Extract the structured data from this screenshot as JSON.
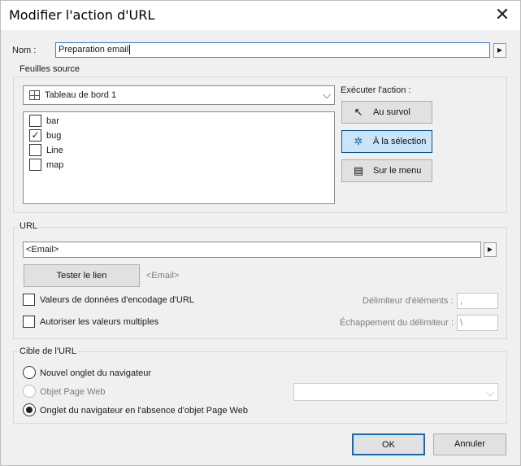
{
  "window": {
    "title": "Modifier l'action d'URL",
    "close_icon": "close-icon"
  },
  "name": {
    "label": "Nom :",
    "value": "Preparation email"
  },
  "sources": {
    "group_title": "Feuilles source",
    "dashboard": "Tableau de bord 1",
    "sheets": [
      {
        "label": "bar",
        "checked": false
      },
      {
        "label": "bug",
        "checked": true
      },
      {
        "label": "Line",
        "checked": false
      },
      {
        "label": "map",
        "checked": false
      }
    ],
    "run_label": "Exécuter l'action :",
    "actions": [
      {
        "label": "Au survol",
        "icon": "cursor-icon",
        "selected": false
      },
      {
        "label": "À la sélection",
        "icon": "cursor-click-icon",
        "selected": true
      },
      {
        "label": "Sur le menu",
        "icon": "menu-cursor-icon",
        "selected": false
      }
    ]
  },
  "url": {
    "group_title": "URL",
    "value": "<Email>",
    "test_button": "Tester le lien",
    "preview": "<Email>",
    "encode_label": "Valeurs de données d'encodage d'URL",
    "multi_label": "Autoriser les valeurs multiples",
    "delimiter_label": "Délimiteur d'éléments :",
    "delimiter_value": ",",
    "escape_label": "Échappement du délimiteur :",
    "escape_value": "\\"
  },
  "target": {
    "group_title": "Cible de l'URL",
    "options": [
      {
        "label": "Nouvel onglet du navigateur",
        "selected": false,
        "disabled": false
      },
      {
        "label": "Objet Page Web",
        "selected": false,
        "disabled": true
      },
      {
        "label": "Onglet du navigateur en l'absence d'objet Page Web",
        "selected": true,
        "disabled": false
      }
    ]
  },
  "footer": {
    "ok": "OK",
    "cancel": "Annuler"
  },
  "colors": {
    "accent": "#0f6cbd",
    "selected_bg": "#cce4f7"
  }
}
